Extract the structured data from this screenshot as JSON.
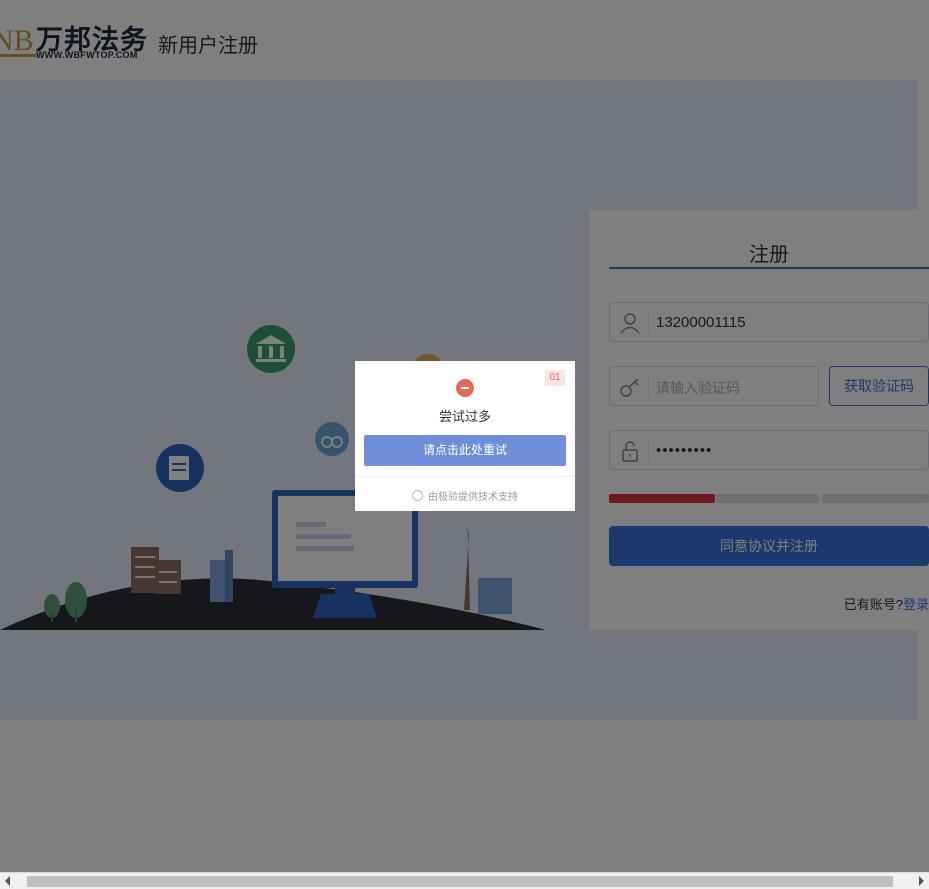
{
  "header": {
    "logo_mark": "NB",
    "logo_name": "万邦法务",
    "logo_url": "WWW.WBFWTOP.COM",
    "page_title": "新用户注册"
  },
  "register": {
    "tab_title": "注册",
    "phone_value": "13200001115",
    "code_placeholder": "请输入验证码",
    "get_code_label": "获取验证码",
    "password_value": "•••••••••",
    "password_strength": 0.33,
    "submit_label": "同意协议并注册",
    "has_account_text": "已有账号?",
    "login_link": "登录"
  },
  "dialog": {
    "badge": "01",
    "message": "尝试过多",
    "retry_label": "请点击此处重试",
    "footer": "由极验提供技术支持"
  },
  "colors": {
    "accent": "#3b72d9",
    "strength_weak": "#d9333f",
    "error_icon": "#e56a5a"
  }
}
